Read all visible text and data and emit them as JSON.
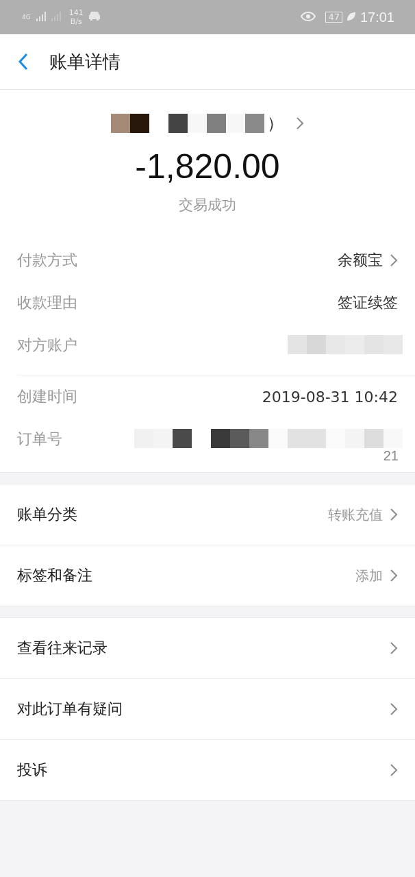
{
  "status_bar": {
    "network": "4G",
    "speed": "141",
    "speed_unit": "B/s",
    "battery": "47",
    "time": "17:01"
  },
  "header": {
    "title": "账单详情"
  },
  "summary": {
    "merchant_tail": "）",
    "amount": "-1,820.00",
    "status": "交易成功"
  },
  "details": [
    {
      "label": "付款方式",
      "value": "余额宝",
      "link": true
    },
    {
      "label": "收款理由",
      "value": "签证续签",
      "link": false
    },
    {
      "label": "对方账户",
      "kind": "redacted"
    },
    {
      "label": "创建时间",
      "value": "2019-08-31 10:42",
      "link": false,
      "divider": true
    },
    {
      "label": "订单号",
      "kind": "redacted",
      "tail": "21"
    }
  ],
  "groups": [
    [
      {
        "label": "账单分类",
        "value": "转账充值"
      },
      {
        "label": "标签和备注",
        "value": "添加"
      }
    ],
    [
      {
        "label": "查看往来记录"
      },
      {
        "label": "对此订单有疑问"
      },
      {
        "label": "投诉"
      }
    ]
  ]
}
